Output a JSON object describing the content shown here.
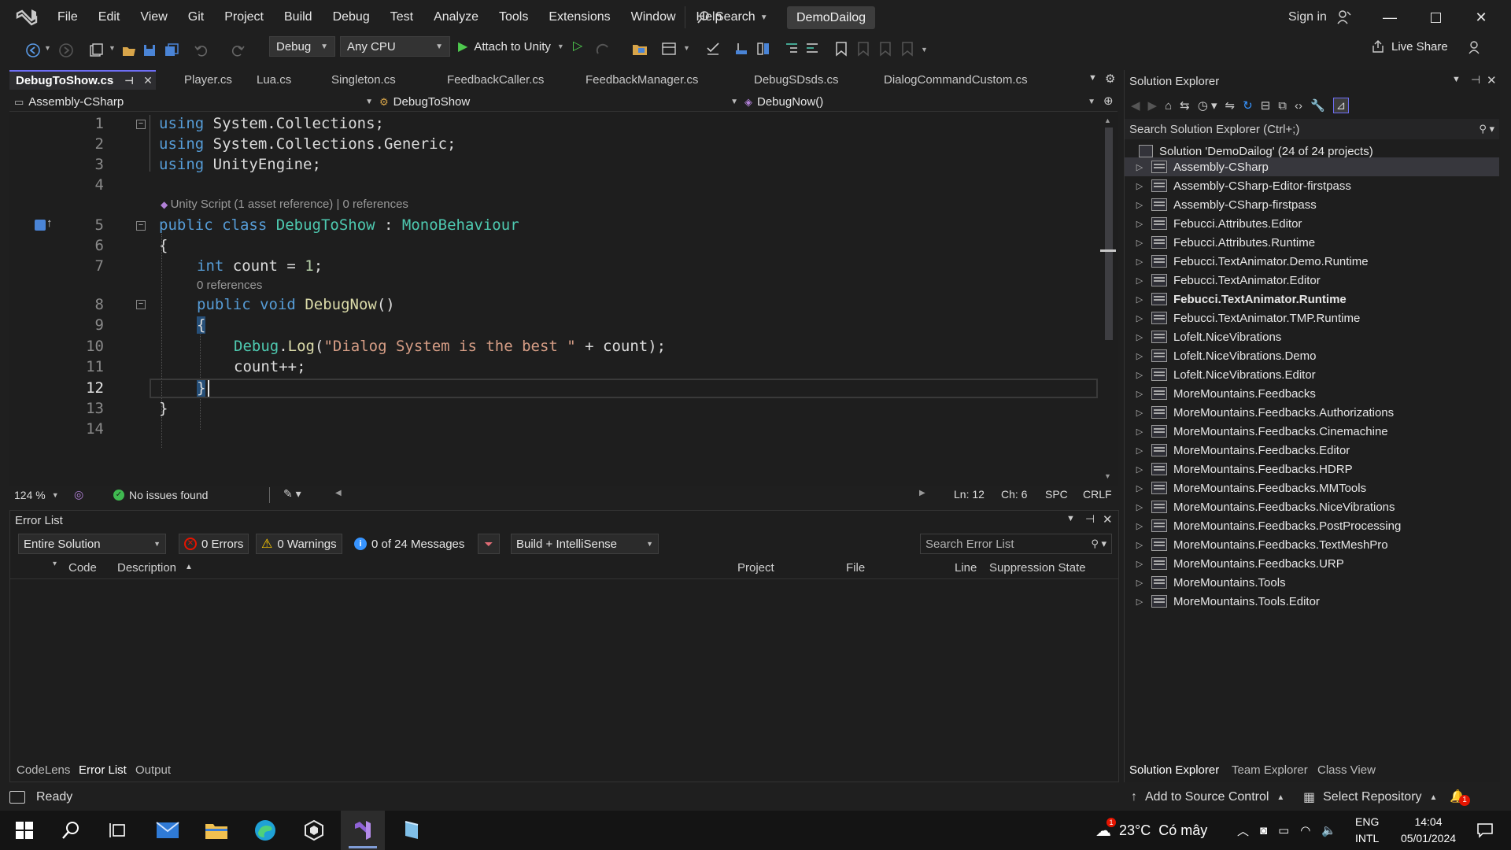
{
  "titlebar": {
    "menu": [
      "File",
      "Edit",
      "View",
      "Git",
      "Project",
      "Build",
      "Debug",
      "Test",
      "Analyze",
      "Tools",
      "Extensions",
      "Window",
      "Help"
    ],
    "search_label": "Search",
    "solution_name": "DemoDailog",
    "signin_label": "Sign in"
  },
  "toolbar": {
    "config": "Debug",
    "platform": "Any CPU",
    "attach_label": "Attach to Unity",
    "liveshare_label": "Live Share"
  },
  "doc_tabs": [
    "DebugToShow.cs",
    "Player.cs",
    "Lua.cs",
    "Singleton.cs",
    "FeedbackCaller.cs",
    "FeedbackManager.cs",
    "DebugSDsds.cs",
    "DialogCommandCustom.cs"
  ],
  "navbar": {
    "project": "Assembly-CSharp",
    "class": "DebugToShow",
    "member": "DebugNow()"
  },
  "editor": {
    "line_numbers": [
      "1",
      "2",
      "3",
      "4",
      "5",
      "6",
      "7",
      "8",
      "9",
      "10",
      "11",
      "12",
      "13",
      "14"
    ],
    "lens_class": "Unity Script (1 asset reference) | 0 references",
    "lens_method": "0 references",
    "code": {
      "l1_kw": "using",
      "l1_rest": " System.Collections;",
      "l2_kw": "using",
      "l2_rest": " System.Collections.Generic;",
      "l3_kw": "using",
      "l3_rest": " UnityEngine;",
      "l5_kw1": "public",
      "l5_kw2": "class",
      "l5_name": "DebugToShow",
      "l5_colon": " : ",
      "l5_base": "MonoBehaviour",
      "l6": "{",
      "l7_kw": "int",
      "l7_rest": " count = ",
      "l7_num": "1",
      "l7_end": ";",
      "l8_kw1": "public",
      "l8_kw2": "void",
      "l8_name": "DebugNow",
      "l8_end": "()",
      "l9": "{",
      "l10_ty": "Debug",
      "l10_dot": ".",
      "l10_mt": "Log",
      "l10_open": "(",
      "l10_str": "\"Dialog System is the best \"",
      "l10_rest": " + count);",
      "l11": "count++;",
      "l12": "}",
      "l13": "}"
    }
  },
  "editor_status": {
    "zoom": "124 %",
    "issues": "No issues found",
    "ln": "Ln: 12",
    "ch": "Ch: 6",
    "spc": "SPC",
    "crlf": "CRLF"
  },
  "error_list": {
    "title": "Error List",
    "scope": "Entire Solution",
    "errors": "0 Errors",
    "warnings": "0 Warnings",
    "messages": "0 of 24 Messages",
    "build_filter": "Build + IntelliSense",
    "search_placeholder": "Search Error List",
    "columns": [
      "Code",
      "Description",
      "Project",
      "File",
      "Line",
      "Suppression State"
    ]
  },
  "bottom_tabs": [
    "CodeLens",
    "Error List",
    "Output"
  ],
  "solution_explorer": {
    "title": "Solution Explorer",
    "search_placeholder": "Search Solution Explorer (Ctrl+;)",
    "solution_label": "Solution 'DemoDailog' (24 of 24 projects)",
    "projects": [
      "Assembly-CSharp",
      "Assembly-CSharp-Editor-firstpass",
      "Assembly-CSharp-firstpass",
      "Febucci.Attributes.Editor",
      "Febucci.Attributes.Runtime",
      "Febucci.TextAnimator.Demo.Runtime",
      "Febucci.TextAnimator.Editor",
      "Febucci.TextAnimator.Runtime",
      "Febucci.TextAnimator.TMP.Runtime",
      "Lofelt.NiceVibrations",
      "Lofelt.NiceVibrations.Demo",
      "Lofelt.NiceVibrations.Editor",
      "MoreMountains.Feedbacks",
      "MoreMountains.Feedbacks.Authorizations",
      "MoreMountains.Feedbacks.Cinemachine",
      "MoreMountains.Feedbacks.Editor",
      "MoreMountains.Feedbacks.HDRP",
      "MoreMountains.Feedbacks.MMTools",
      "MoreMountains.Feedbacks.NiceVibrations",
      "MoreMountains.Feedbacks.PostProcessing",
      "MoreMountains.Feedbacks.TextMeshPro",
      "MoreMountains.Feedbacks.URP",
      "MoreMountains.Tools",
      "MoreMountains.Tools.Editor"
    ],
    "bottom_tabs": [
      "Solution Explorer",
      "Team Explorer",
      "Class View"
    ]
  },
  "statusbar": {
    "ready": "Ready",
    "source_control": "Add to Source Control",
    "repository": "Select Repository",
    "notif_count": "1"
  },
  "taskbar": {
    "weather_temp": "23°C",
    "weather_desc": "Có mây",
    "lang1": "ENG",
    "lang2": "INTL",
    "time": "14:04",
    "date": "05/01/2024",
    "weather_badge": "1"
  },
  "colors": {
    "accent": "#6e6ef5",
    "keyword": "#569cd6",
    "type": "#4ec9b0",
    "string": "#d69d85",
    "error_red": "#e51400"
  }
}
